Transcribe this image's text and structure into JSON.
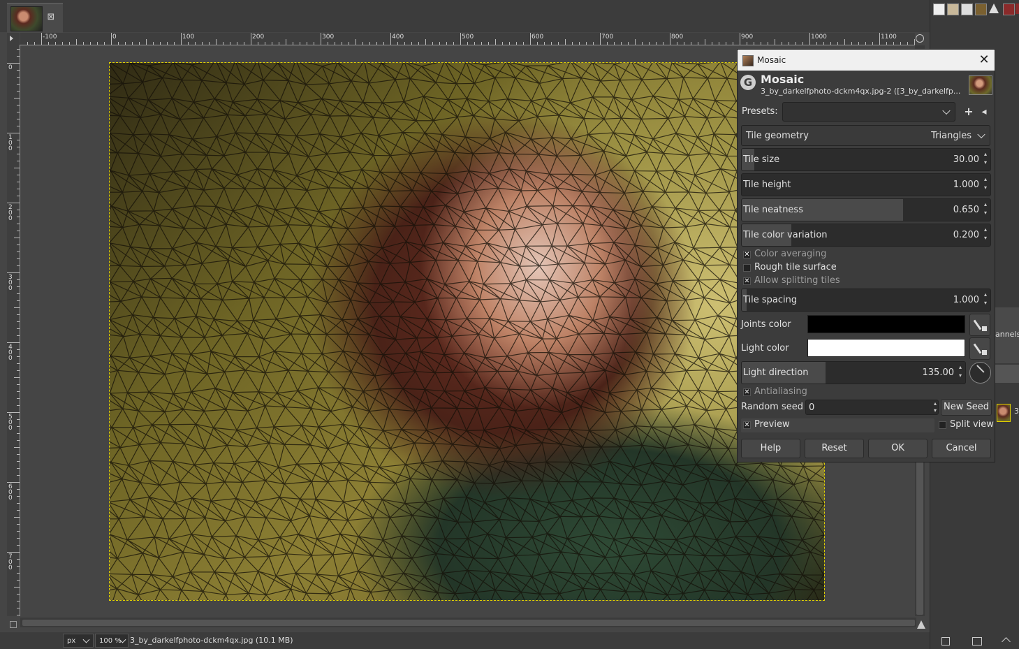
{
  "window": {
    "image_tab_close_glyph": "⊠",
    "status_file": "3_by_darkelfphoto-dckm4qx.jpg (10.1 MB)",
    "unit_value": "px",
    "zoom_value": "100 %"
  },
  "rulers": {
    "horizontal_labels": [
      "-100",
      "0",
      "100",
      "200",
      "300",
      "400",
      "500",
      "600",
      "700",
      "800",
      "900",
      "1000",
      "1100"
    ],
    "vertical_labels": [
      "0",
      "100",
      "200",
      "300",
      "400",
      "500",
      "600",
      "700"
    ]
  },
  "dock": {
    "partial_tab_label": "annels",
    "partial_layer_label": "3_"
  },
  "dialog": {
    "window_title": "Mosaic",
    "close_glyph": "✕",
    "logo_letter": "G",
    "heading": "Mosaic",
    "subtitle": "3_by_darkelfphoto-dckm4qx.jpg-2 ([3_by_darkelfp...",
    "presets_label": "Presets:",
    "presets_value": "",
    "add_preset_glyph": "+",
    "manage_preset_glyph": "◂",
    "tile_geometry_label": "Tile geometry",
    "tile_geometry_value": "Triangles",
    "spinners": [
      {
        "label": "Tile size",
        "value": "30.00",
        "fill": 0.05
      },
      {
        "label": "Tile height",
        "value": "1.000",
        "fill": 0.0
      },
      {
        "label": "Tile neatness",
        "value": "0.650",
        "fill": 0.65
      },
      {
        "label": "Tile color variation",
        "value": "0.200",
        "fill": 0.2
      }
    ],
    "color_averaging_label": "Color averaging",
    "color_averaging_checked": true,
    "rough_tile_label": "Rough tile surface",
    "rough_tile_checked": false,
    "allow_splitting_label": "Allow splitting tiles",
    "allow_splitting_checked": true,
    "tile_spacing": {
      "label": "Tile spacing",
      "value": "1.000",
      "fill": 0.02
    },
    "joints_color_label": "Joints color",
    "joints_color": "#000000",
    "light_color_label": "Light color",
    "light_color": "#ffffff",
    "light_direction": {
      "label": "Light direction",
      "value": "135.00",
      "fill": 0.375
    },
    "antialiasing_label": "Antialiasing",
    "antialiasing_checked": true,
    "random_seed_label": "Random seed",
    "random_seed_value": "0",
    "new_seed_label": "New Seed",
    "preview_label": "Preview",
    "preview_checked": true,
    "split_view_label": "Split view",
    "split_view_checked": false,
    "buttons": {
      "help": "Help",
      "reset": "Reset",
      "ok": "OK",
      "cancel": "Cancel"
    }
  },
  "icons": {
    "check_glyph": "✕",
    "spin_up": "▴",
    "spin_down": "▾"
  }
}
